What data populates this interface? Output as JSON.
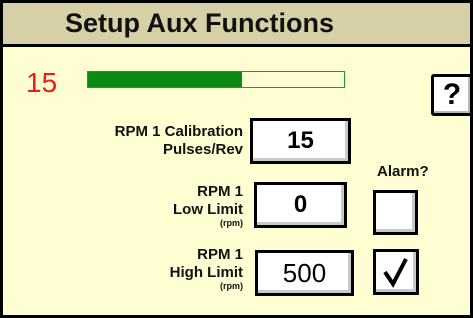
{
  "header": {
    "title": "Setup Aux Functions"
  },
  "status": {
    "value": "15",
    "progress_fraction": 0.6
  },
  "help_button": {
    "label": "?"
  },
  "calibration": {
    "label_line1": "RPM 1 Calibration",
    "label_line2": "Pulses/Rev",
    "value": "15"
  },
  "alarm_header": "Alarm?",
  "low_limit": {
    "label_line1": "RPM 1",
    "label_line2": "Low Limit",
    "unit": "(rpm)",
    "value": "0",
    "alarm_checked": false
  },
  "high_limit": {
    "label_line1": "RPM 1",
    "label_line2": "High Limit",
    "unit": "(rpm)",
    "value": "500",
    "alarm_checked": true
  },
  "colors": {
    "background": "#fffdd2",
    "header": "#d6d0a6",
    "readout": "#ee1c1c",
    "progress": "#0c8a17"
  }
}
